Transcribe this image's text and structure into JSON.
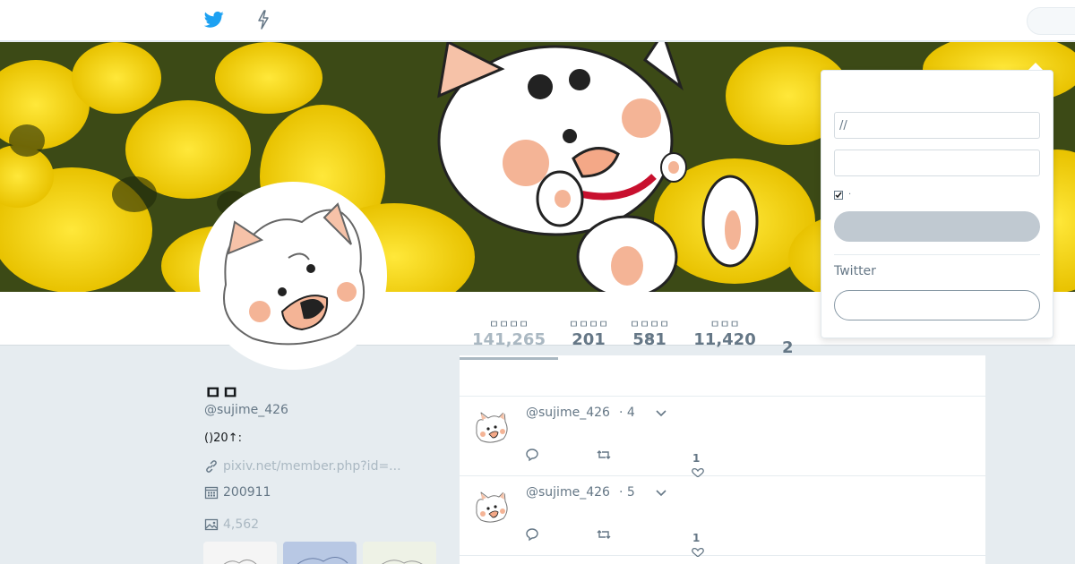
{
  "nav": {
    "home_icon": "twitter-bird-icon",
    "moments_icon": "lightning-icon"
  },
  "profile": {
    "name": "ㅁㅁ",
    "handle": "@sujime_426",
    "bio": "()20↑:",
    "link": "pixiv.net/member.php?id=...",
    "joined": "200911",
    "media_count": "4,562"
  },
  "stats": [
    {
      "label": "ㅁㅁㅁㅁ",
      "value": "141,265",
      "active": true
    },
    {
      "label": "ㅁㅁㅁㅁ",
      "value": "201",
      "active": false
    },
    {
      "label": "ㅁㅁㅁㅁㅁ",
      "value": "581",
      "active": false
    },
    {
      "label": "ㅁㅁㅁ",
      "value": "11,420",
      "active": false
    }
  ],
  "lists_count": "2",
  "tweets": [
    {
      "handle": "@sujime_426",
      "time": "· 4",
      "likes": "1"
    },
    {
      "handle": "@sujime_426",
      "time": "· 5",
      "likes": "1"
    }
  ],
  "login": {
    "username_value": "//",
    "password_value": "",
    "remember_label": "·",
    "twitter_label": "Twitter"
  },
  "colors": {
    "accent": "#1da1f2",
    "muted": "#657786",
    "faded": "#aab8c2",
    "background": "#e6ecf0"
  }
}
